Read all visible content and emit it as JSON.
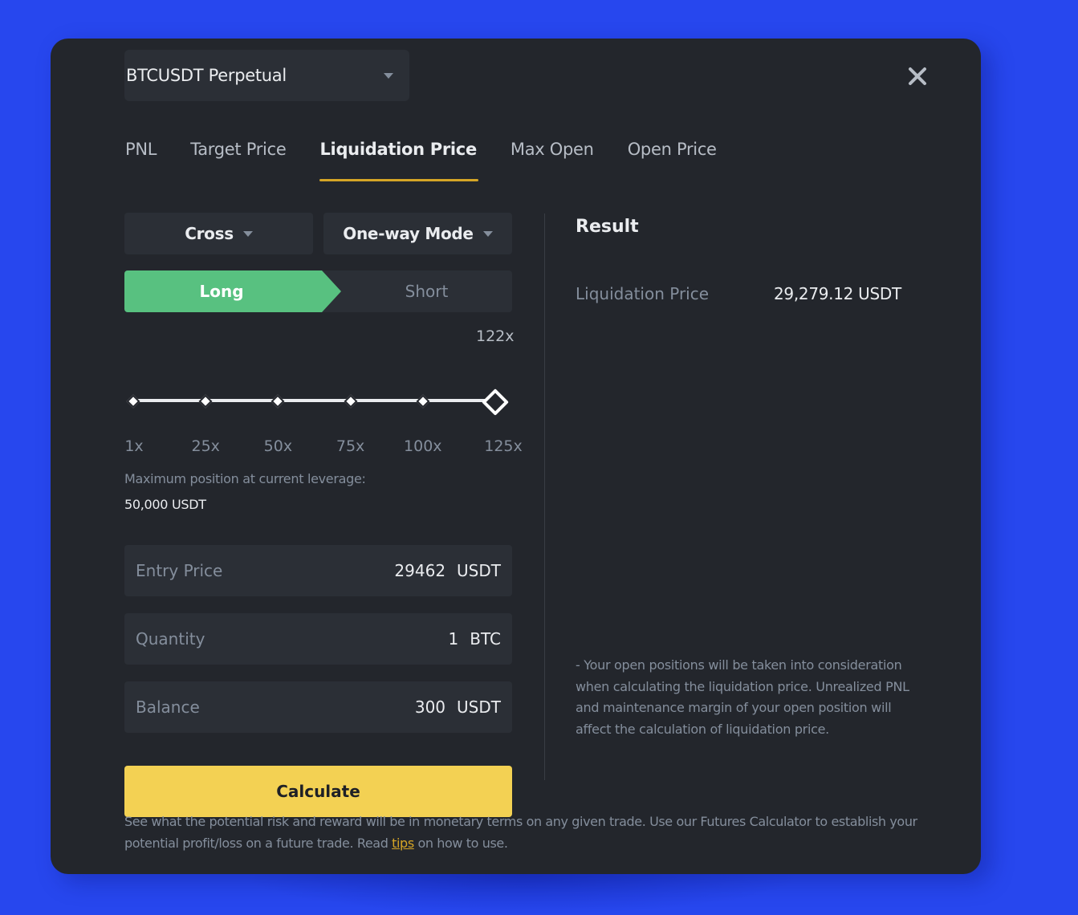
{
  "symbol_select": {
    "label": "BTCUSDT Perpetual",
    "icon": "caret-down-icon"
  },
  "close_icon": "close-icon",
  "tabs": [
    {
      "label": "PNL",
      "active": false
    },
    {
      "label": "Target Price",
      "active": false
    },
    {
      "label": "Liquidation Price",
      "active": true
    },
    {
      "label": "Max Open",
      "active": false
    },
    {
      "label": "Open Price",
      "active": false
    }
  ],
  "form": {
    "margin_mode": "Cross",
    "position_mode": "One-way Mode",
    "side": {
      "long_label": "Long",
      "short_label": "Short",
      "selected": "Long"
    },
    "leverage": {
      "current_label": "122x",
      "current": 122,
      "min": 1,
      "max": 125,
      "ticks": [
        "1x",
        "25x",
        "50x",
        "75x",
        "100x",
        "125x"
      ]
    },
    "max_position_label": "Maximum position at current leverage:",
    "max_position_value": "50,000 USDT",
    "fields": [
      {
        "label": "Entry Price",
        "value": "29462",
        "unit": "USDT"
      },
      {
        "label": "Quantity",
        "value": "1",
        "unit": "BTC"
      },
      {
        "label": "Balance",
        "value": "300",
        "unit": "USDT"
      }
    ],
    "calculate_label": "Calculate"
  },
  "result": {
    "title": "Result",
    "label": "Liquidation Price",
    "value": "29,279.12 USDT",
    "note": "- Your open positions will be taken into consideration when calculating the liquidation price. Unrealized PNL and maintenance margin of your open position will affect the calculation of liquidation price."
  },
  "footer": {
    "text_before": "See what the potential risk and reward will be in monetary terms on any given trade. Use our Futures Calculator to establish your potential profit/loss on a future trade. Read ",
    "link": "tips",
    "text_after": " on how to use."
  },
  "colors": {
    "background": "#2747ee",
    "panel": "#23262c",
    "long": "#58c180",
    "accent": "#f3d153",
    "tab_underline": "#d5a526"
  }
}
